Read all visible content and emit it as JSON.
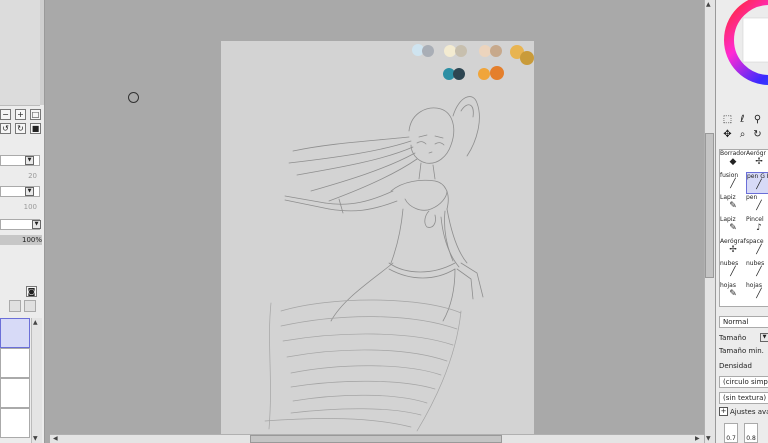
{
  "left_panel": {
    "size_values": [
      "20",
      "100"
    ],
    "opacity": "100%"
  },
  "palette": [
    "#cfe4f0",
    "#a9aeb6",
    "#f3ebd1",
    "#c7bfae",
    "#ecd4bd",
    "#c7a98c",
    "#e8b451",
    "#c99b3a",
    "#2c8fa4",
    "#2e4652",
    "#f0a53a",
    "#e47f2c"
  ],
  "brushes": [
    {
      "label": "Borrador",
      "icon": "eraser-icon",
      "selected": false
    },
    {
      "label": "Aerógr",
      "icon": "airbrush-icon",
      "selected": false
    },
    {
      "label": "fusion",
      "icon": "pen-icon",
      "selected": false
    },
    {
      "label": "pen G Pen",
      "icon": "pen-icon",
      "selected": true
    },
    {
      "label": "Lapiz",
      "icon": "pencil-icon",
      "selected": false
    },
    {
      "label": "pen",
      "icon": "pen-icon",
      "selected": false
    },
    {
      "label": "Lapiz",
      "icon": "pencil-icon",
      "selected": false
    },
    {
      "label": "Pincel",
      "icon": "brush-icon",
      "selected": false
    },
    {
      "label": "Aerógraf",
      "icon": "airbrush-icon",
      "selected": false
    },
    {
      "label": "space",
      "icon": "pen-icon",
      "selected": false
    },
    {
      "label": "nubes",
      "icon": "pen-icon",
      "selected": false
    },
    {
      "label": "nubes",
      "icon": "pen-icon",
      "selected": false
    },
    {
      "label": "hojas",
      "icon": "pencil-icon",
      "selected": false
    },
    {
      "label": "hojas",
      "icon": "pen-icon",
      "selected": false
    }
  ],
  "brush_settings": {
    "blend_mode": "Normal",
    "size_label": "Tamaño",
    "min_size_label": "Tamaño min.",
    "density_label": "Densidad",
    "shape": "(circulo simple)",
    "texture": "(sin textura)",
    "advanced_label": "Ajustes ava",
    "value_1": "0.7",
    "value_2": "0.8"
  }
}
